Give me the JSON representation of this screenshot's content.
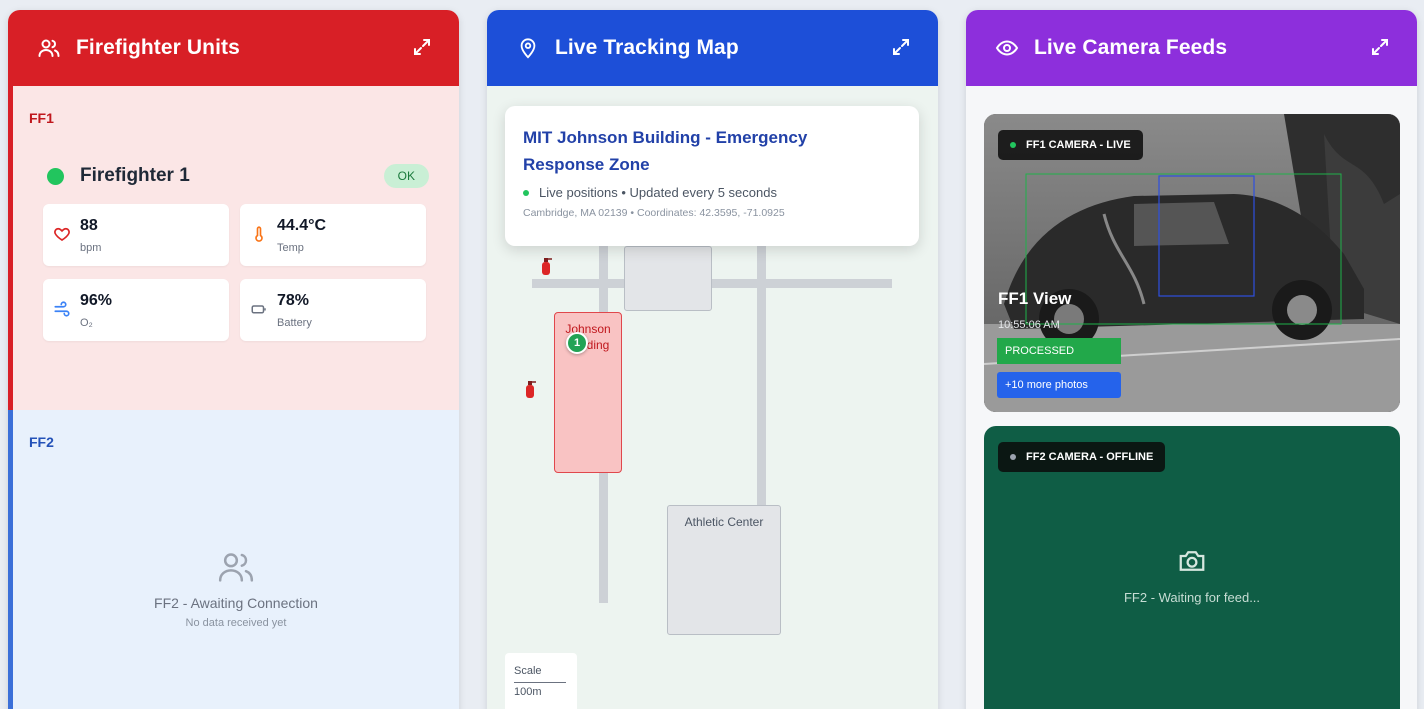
{
  "panels": {
    "units": {
      "title": "Firefighter Units",
      "ff1": {
        "code": "FF1",
        "name": "Firefighter 1",
        "status": "OK",
        "stats": [
          {
            "value": "88",
            "label": "bpm"
          },
          {
            "value": "44.4°C",
            "label": "Temp"
          },
          {
            "value": "96%",
            "label": "O₂"
          },
          {
            "value": "78%",
            "label": "Battery"
          }
        ]
      },
      "ff2": {
        "code": "FF2",
        "awaiting": "FF2 - Awaiting Connection",
        "no_data": "No data received yet"
      }
    },
    "map": {
      "title": "Live Tracking Map",
      "card_title": "MIT Johnson Building - Emergency Response Zone",
      "status": "Live positions • Updated every 5 seconds",
      "location": "Cambridge, MA 02139 • Coordinates: 42.3595, -71.0925",
      "johnson_label": "Johnson Building",
      "marker": "1",
      "athletic_label": "Athletic Center",
      "scale_label": "Scale",
      "scale_value": "100m"
    },
    "cameras": {
      "title": "Live Camera Feeds",
      "ff1_badge": "FF1 CAMERA - LIVE",
      "ff1_view": "FF1 View",
      "ff1_time": "10:55:06 AM",
      "processed": "PROCESSED",
      "more_photos": "+10 more photos",
      "ff2_badge": "FF2 CAMERA - OFFLINE",
      "ff2_waiting": "FF2 - Waiting for feed..."
    }
  },
  "colors": {
    "units_header": "#d81f26",
    "map_header": "#1d4fd8",
    "camera_header": "#8d2fdc",
    "status_ok": "#22c55e"
  }
}
